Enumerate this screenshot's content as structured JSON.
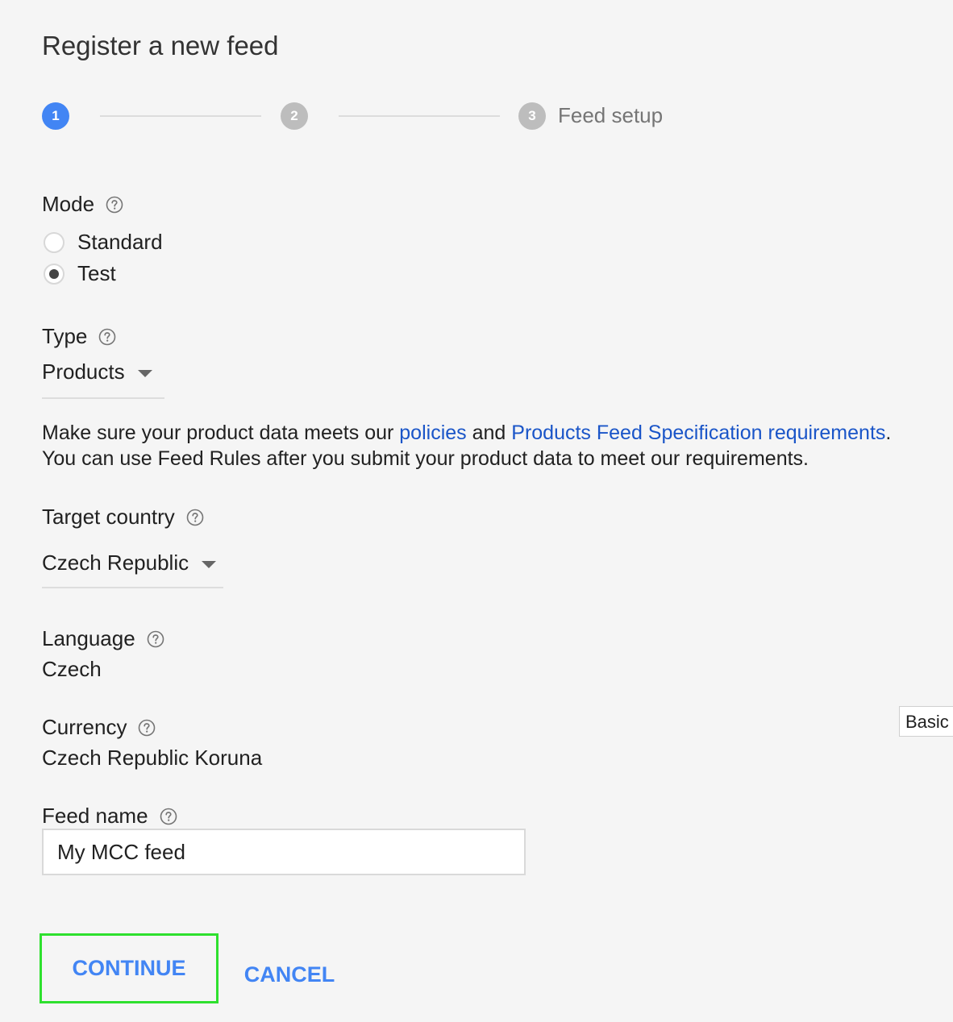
{
  "page": {
    "title": "Register a new feed"
  },
  "stepper": {
    "steps": [
      {
        "number": "1",
        "label": "",
        "state": "active"
      },
      {
        "number": "2",
        "label": "",
        "state": "inactive"
      },
      {
        "number": "3",
        "label": "Feed setup",
        "state": "inactive"
      }
    ]
  },
  "mode": {
    "label": "Mode",
    "options": [
      "Standard",
      "Test"
    ],
    "selected": "Test"
  },
  "type": {
    "label": "Type",
    "value": "Products"
  },
  "info": {
    "text_before": "Make sure your product data meets our ",
    "link_policies": "policies",
    "text_and": " and ",
    "link_spec": "Products Feed Specification requirements",
    "text_period": ".",
    "line2": "You can use Feed Rules after you submit your product data to meet our requirements."
  },
  "target_country": {
    "label": "Target country",
    "value": "Czech Republic"
  },
  "language": {
    "label": "Language",
    "value": "Czech"
  },
  "currency": {
    "label": "Currency",
    "value": "Czech Republic Koruna"
  },
  "feed_name": {
    "label": "Feed name",
    "value": "My MCC feed"
  },
  "actions": {
    "continue_label": "CONTINUE",
    "cancel_label": "CANCEL"
  },
  "side_tab": {
    "label": "Basic"
  },
  "colors": {
    "accent": "#4285f4",
    "link": "#1a55c8",
    "highlight_border": "#2ee02e",
    "background": "#f5f5f5"
  },
  "icons": {
    "help": "help-circle-icon",
    "dropdown": "caret-down-icon"
  }
}
